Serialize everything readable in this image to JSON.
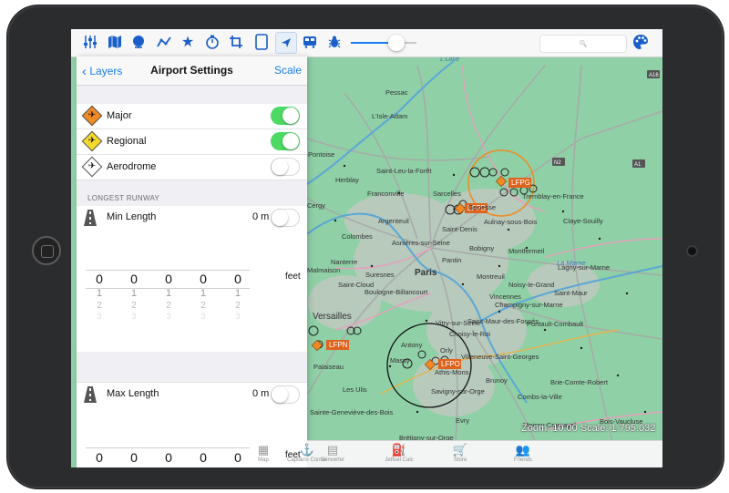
{
  "toolbar": {
    "icons": [
      "sliders-icon",
      "map-icon",
      "globe-icon",
      "route-icon",
      "star-icon",
      "timer-icon",
      "crop-icon",
      "tablet-icon",
      "location-arrow-icon",
      "train-icon",
      "bug-icon"
    ],
    "slider_level": 0.7,
    "search_glyph": "🔍",
    "palette_icon": "palette-icon"
  },
  "panel": {
    "back_label": "Layers",
    "title": "Airport Settings",
    "right_label": "Scale",
    "airport_types": [
      {
        "label": "Major",
        "color": "#f08a24",
        "enabled": true
      },
      {
        "label": "Regional",
        "color": "#f5d92a",
        "enabled": true
      },
      {
        "label": "Aerodrome",
        "color": "#ffffff",
        "enabled": false
      }
    ],
    "section_header": "LONGEST RUNWAY",
    "min": {
      "label": "Min Length",
      "value": "0 m",
      "unit": "feet",
      "digits": [
        "0",
        "0",
        "0",
        "0",
        "0"
      ],
      "next": [
        "1",
        "1",
        "1",
        "1",
        "1"
      ],
      "next2": [
        "2",
        "2",
        "2",
        "2",
        "2"
      ],
      "next3": [
        "3",
        "3",
        "3",
        "3",
        "3"
      ]
    },
    "max": {
      "label": "Max Length",
      "value": "0 m",
      "unit": "feet",
      "digits": [
        "0",
        "0",
        "0",
        "0",
        "0"
      ],
      "next": [
        "1",
        "1",
        "1",
        "1",
        "1"
      ]
    }
  },
  "map": {
    "places": [
      {
        "name": "L'Oise"
      },
      {
        "name": "Pessac"
      },
      {
        "name": "L'Isle-Adam"
      },
      {
        "name": "Pontoise"
      },
      {
        "name": "Saint-Leu-la-Forêt"
      },
      {
        "name": "Herblay"
      },
      {
        "name": "Franconville"
      },
      {
        "name": "Sarcelles"
      },
      {
        "name": "Cergy"
      },
      {
        "name": "Argenteuil"
      },
      {
        "name": "Saint-Denis"
      },
      {
        "name": "Aulnay-sous-Bois"
      },
      {
        "name": "Colombes"
      },
      {
        "name": "Asnières-sur-Seine"
      },
      {
        "name": "Bobigny"
      },
      {
        "name": "Montfermeil"
      },
      {
        "name": "Nanterre"
      },
      {
        "name": "Pantin"
      },
      {
        "name": "Malmaison"
      },
      {
        "name": "Suresnes"
      },
      {
        "name": "Paris"
      },
      {
        "name": "Montreuil"
      },
      {
        "name": "Noisy-le-Grand"
      },
      {
        "name": "Saint-Cloud"
      },
      {
        "name": "Boulogne-Billancourt"
      },
      {
        "name": "Vincennes"
      },
      {
        "name": "Champigny-sur-Marne"
      },
      {
        "name": "Versailles"
      },
      {
        "name": "Saint-Maur-des-Fossés"
      },
      {
        "name": "Vitry-sur-Seine"
      },
      {
        "name": "Choisy-le-Roi"
      },
      {
        "name": "Pontault-Combault"
      },
      {
        "name": "Antony"
      },
      {
        "name": "Orly"
      },
      {
        "name": "Villeneuve-Saint-Georges"
      },
      {
        "name": "Palaiseau"
      },
      {
        "name": "Massy"
      },
      {
        "name": "Athis-Mons"
      },
      {
        "name": "Brunoy"
      },
      {
        "name": "Les Ulis"
      },
      {
        "name": "Savigny-sur-Orge"
      },
      {
        "name": "Combs-la-Ville"
      },
      {
        "name": "Sainte-Geneviève-des-Bois"
      },
      {
        "name": "Evry"
      },
      {
        "name": "Brétigny-sur-Orge"
      },
      {
        "name": "Claye-Souilly"
      },
      {
        "name": "Lagny-sur-Marne"
      },
      {
        "name": "Saint-Maur"
      },
      {
        "name": "Brie-Comte-Robert"
      },
      {
        "name": "Tremblay-en-France"
      },
      {
        "name": "Gonesse"
      },
      {
        "name": "La Marne"
      },
      {
        "name": "Moissy-Cramayel"
      },
      {
        "name": "Bois-Vaucluse"
      }
    ],
    "airports": [
      {
        "code": "LFPG"
      },
      {
        "code": "LFPB"
      },
      {
        "code": "LFPO"
      },
      {
        "code": "LFPN"
      }
    ],
    "roads": [
      {
        "name": "A16"
      },
      {
        "name": "N2"
      },
      {
        "name": "A1"
      }
    ],
    "zoom_text": "Zoom: 10.00  Scale: 1:795.032"
  },
  "tabbar": {
    "tabs": [
      {
        "label": "Map",
        "icon": "map-icon"
      },
      {
        "label": "Captains Corner",
        "icon": "captain-icon"
      },
      {
        "label": "Converter",
        "icon": "calculator-icon"
      },
      {
        "label": "Jetfuel Calc",
        "icon": "fuel-pump-icon"
      },
      {
        "label": "Store",
        "icon": "cart-icon"
      },
      {
        "label": "Friends",
        "icon": "friends-icon"
      }
    ]
  },
  "colors": {
    "accent": "#1a7cf0",
    "toggle_on": "#4cd964",
    "map_base": "#8fd0a6",
    "airport_orange": "#f08a24"
  }
}
